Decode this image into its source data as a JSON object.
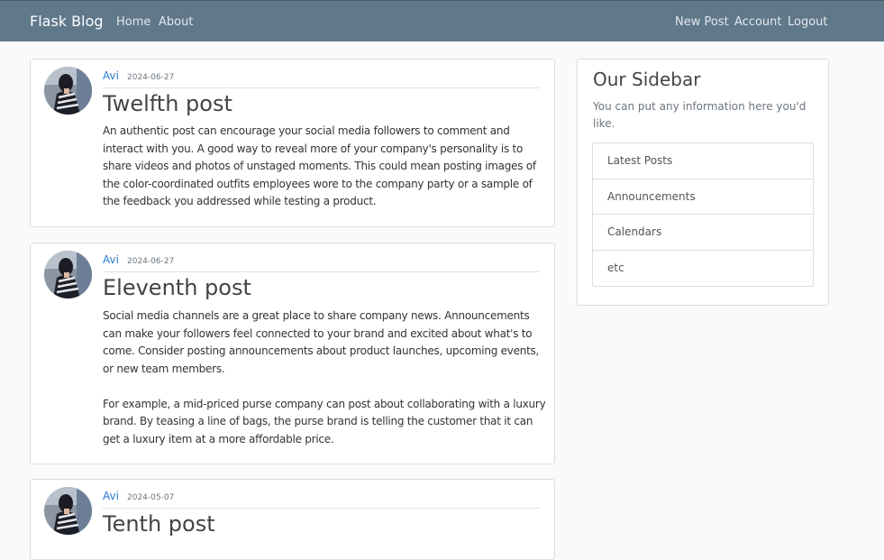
{
  "navbar": {
    "brand": "Flask Blog",
    "left_links": [
      "Home",
      "About"
    ],
    "right_links": [
      "New Post",
      "Account",
      "Logout"
    ],
    "color": "#5f788a"
  },
  "posts": [
    {
      "author": "Avi",
      "date": "2024-06-27",
      "title": "Twelfth post",
      "content": "An authentic post can encourage your social media followers to comment and interact with you. A good way to reveal more of your company's personality is to share videos and photos of unstaged moments. This could mean posting images of the color-coordinated outfits employees wore to the company party or a sample of the feedback you addressed while testing a product."
    },
    {
      "author": "Avi",
      "date": "2024-06-27",
      "title": "Eleventh post",
      "content": "Social media channels are a great place to share company news. Announcements can make your followers feel connected to your brand and excited about what's to come. Consider posting announcements about product launches, upcoming events, or new team members.\n\nFor example, a mid-priced purse company can post about collaborating with a luxury brand. By teasing a line of bags, the purse brand is telling the customer that it can get a luxury item at a more affordable price."
    },
    {
      "author": "Avi",
      "date": "2024-05-07",
      "title": "Tenth post",
      "content": ""
    }
  ],
  "sidebar": {
    "title": "Our Sidebar",
    "description": "You can put any information here you'd like.",
    "items": [
      "Latest Posts",
      "Announcements",
      "Calendars",
      "etc"
    ]
  },
  "icons": {
    "avatar": "profile-avatar-icon"
  },
  "colors": {
    "link": "#2b7bd6",
    "background": "#fafafa"
  }
}
